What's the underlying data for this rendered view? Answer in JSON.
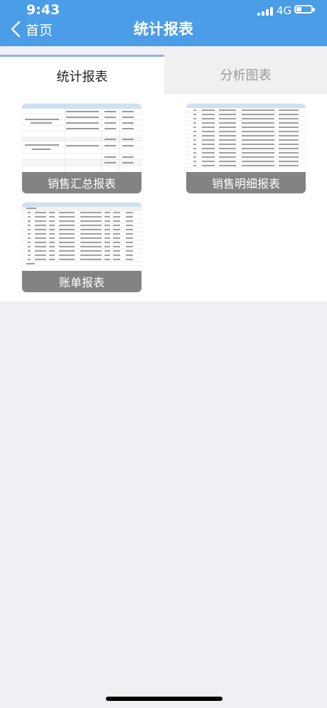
{
  "status_bar": {
    "time": "9:43",
    "network": "4G",
    "battery_level": 0.35
  },
  "nav": {
    "back_label": "首页",
    "title": "统计报表"
  },
  "tabs": [
    {
      "label": "统计报表",
      "active": true
    },
    {
      "label": "分析图表",
      "active": false
    }
  ],
  "reports": [
    {
      "label": "销售汇总报表",
      "thumbnail": "sales-summary-thumbnail"
    },
    {
      "label": "销售明细报表",
      "thumbnail": "sales-detail-thumbnail"
    },
    {
      "label": "账单报表",
      "thumbnail": "bill-thumbnail"
    }
  ],
  "colors": {
    "header": "#4a9de6",
    "tab_active_border": "#8bb7e0",
    "card_label_bg": "#787878",
    "page_bg": "#efeff4"
  }
}
